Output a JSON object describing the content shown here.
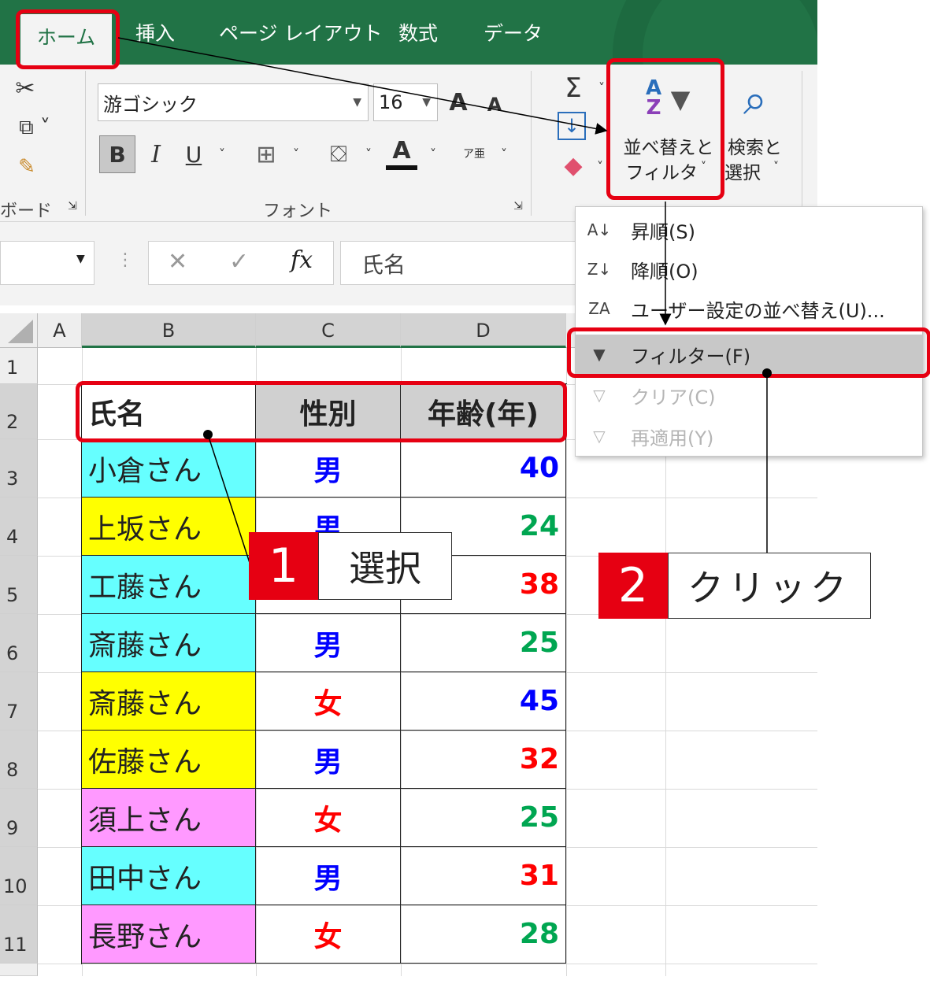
{
  "ribbon": {
    "tabs": [
      "ホーム",
      "挿入",
      "ページ レイアウト",
      "数式",
      "データ"
    ],
    "font_name": "游ゴシック",
    "font_size": "16",
    "grow_font": "A",
    "shrink_font": "A",
    "bold": "B",
    "italic": "I",
    "underline": "U",
    "sort_filter_line1": "並べ替えと",
    "sort_filter_line2": "フィルター",
    "find_line1": "検索と",
    "find_line2": "選択",
    "group_font": "フォント",
    "group_clipboard": "ボード",
    "sigma": "Σ",
    "phonetic": "ア亜"
  },
  "formula_bar": {
    "fx": "fx",
    "value": "氏名",
    "cancel": "✕",
    "enter": "✓"
  },
  "columns": [
    "A",
    "B",
    "C",
    "D"
  ],
  "rows": [
    "1",
    "2",
    "3",
    "4",
    "5",
    "6",
    "7",
    "8",
    "9",
    "10",
    "11"
  ],
  "table": {
    "headers": [
      "氏名",
      "性別",
      "年齢(年)"
    ],
    "records": [
      {
        "name": "小倉さん",
        "gender": "男",
        "age": "40",
        "name_bg": "#66ffff",
        "gender_color": "#0000ff",
        "age_color": "#0000ff"
      },
      {
        "name": "上坂さん",
        "gender": "男",
        "age": "24",
        "name_bg": "#ffff00",
        "gender_color": "#0000ff",
        "age_color": "#00a651"
      },
      {
        "name": "工藤さん",
        "gender": "",
        "age": "38",
        "name_bg": "#66ffff",
        "gender_color": "#0000ff",
        "age_color": "#ff0000"
      },
      {
        "name": "斎藤さん",
        "gender": "男",
        "age": "25",
        "name_bg": "#66ffff",
        "gender_color": "#0000ff",
        "age_color": "#00a651"
      },
      {
        "name": "斎藤さん",
        "gender": "女",
        "age": "45",
        "name_bg": "#ffff00",
        "gender_color": "#ff0000",
        "age_color": "#0000ff"
      },
      {
        "name": "佐藤さん",
        "gender": "男",
        "age": "32",
        "name_bg": "#ffff00",
        "gender_color": "#0000ff",
        "age_color": "#ff0000"
      },
      {
        "name": "須上さん",
        "gender": "女",
        "age": "25",
        "name_bg": "#ff99ff",
        "gender_color": "#ff0000",
        "age_color": "#00a651"
      },
      {
        "name": "田中さん",
        "gender": "男",
        "age": "31",
        "name_bg": "#66ffff",
        "gender_color": "#0000ff",
        "age_color": "#ff0000"
      },
      {
        "name": "長野さん",
        "gender": "女",
        "age": "28",
        "name_bg": "#ff99ff",
        "gender_color": "#ff0000",
        "age_color": "#00a651"
      }
    ]
  },
  "menu": {
    "items": [
      {
        "label": "昇順(S)",
        "icon": "sort-ascending-icon",
        "glyph": "A↓",
        "disabled": false
      },
      {
        "label": "降順(O)",
        "icon": "sort-descending-icon",
        "glyph": "Z↓",
        "disabled": false
      },
      {
        "label": "ユーザー設定の並べ替え(U)...",
        "icon": "custom-sort-icon",
        "glyph": "ZA",
        "disabled": false
      },
      {
        "label": "フィルター(F)",
        "icon": "filter-icon",
        "glyph": "▼",
        "disabled": false,
        "highlighted": true
      },
      {
        "label": "クリア(C)",
        "icon": "filter-clear-icon",
        "glyph": "▽",
        "disabled": true
      },
      {
        "label": "再適用(Y)",
        "icon": "filter-reapply-icon",
        "glyph": "▽",
        "disabled": true
      }
    ]
  },
  "annotations": {
    "step1_num": "1",
    "step1_label": "選択",
    "step2_num": "2",
    "step2_label": "クリック",
    "highlight_color": "#e60012"
  },
  "colors": {
    "excel_green": "#217346",
    "ribbon_bg": "#f3f3f3"
  }
}
